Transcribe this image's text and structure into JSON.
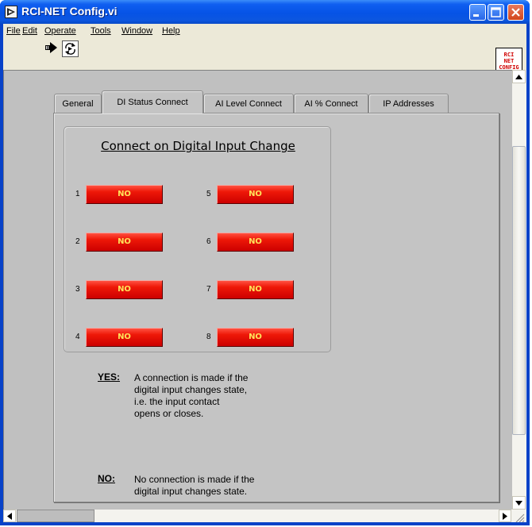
{
  "window": {
    "title": "RCI-NET Config.vi",
    "icon": "labview-vi-icon"
  },
  "menubar": {
    "items": [
      {
        "label": "File"
      },
      {
        "label": "Edit"
      },
      {
        "label": "Operate"
      },
      {
        "label": "Tools"
      },
      {
        "label": "Window"
      },
      {
        "label": "Help"
      }
    ]
  },
  "vi_icon": {
    "line1": "RCI",
    "line2": "NET",
    "line3": "CONFIG"
  },
  "tabs": [
    {
      "label": "General",
      "active": false
    },
    {
      "label": "DI Status Connect",
      "active": true
    },
    {
      "label": "AI Level Connect",
      "active": false
    },
    {
      "label": "AI % Connect",
      "active": false
    },
    {
      "label": "IP Addresses",
      "active": false
    }
  ],
  "group": {
    "title": "Connect on Digital Input Change",
    "inputs": [
      {
        "number": "1",
        "state": "NO"
      },
      {
        "number": "2",
        "state": "NO"
      },
      {
        "number": "3",
        "state": "NO"
      },
      {
        "number": "4",
        "state": "NO"
      },
      {
        "number": "5",
        "state": "NO"
      },
      {
        "number": "6",
        "state": "NO"
      },
      {
        "number": "7",
        "state": "NO"
      },
      {
        "number": "8",
        "state": "NO"
      }
    ]
  },
  "notes": {
    "yes_label": "YES:",
    "yes_text": "A connection is made if the\ndigital input changes state,\ni.e. the input contact\nopens or closes.",
    "no_label": "NO:",
    "no_text": "No connection is made if the\ndigital input changes state."
  },
  "colors": {
    "titlebar": "#0653e6",
    "panel_bg": "#c0c0c0",
    "led_off": "#dd0a00",
    "led_text": "#ffe25a"
  }
}
